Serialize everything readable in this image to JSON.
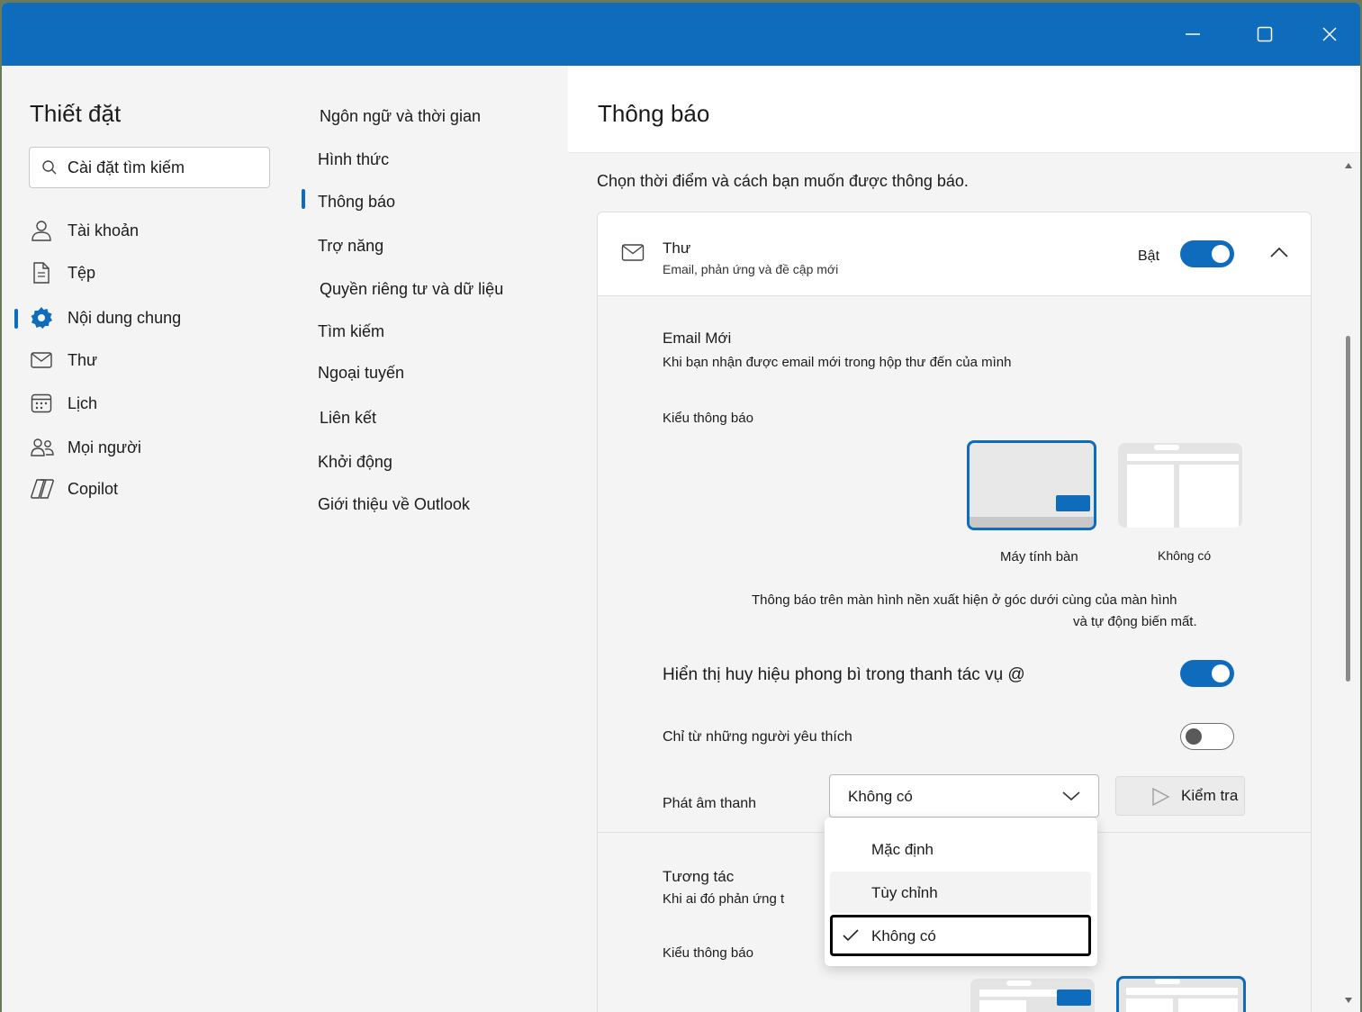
{
  "window": {
    "minimize_icon": "minimize-icon",
    "maximize_icon": "maximize-icon",
    "close_icon": "close-icon",
    "accent": "#0f6cbd"
  },
  "nav": {
    "title": "Thiết đặt",
    "search_placeholder": "Cài đặt tìm kiếm",
    "items": [
      {
        "label": "Tài khoản",
        "icon": "person-icon"
      },
      {
        "label": "Tệp",
        "icon": "document-icon"
      },
      {
        "label": "Nội dung chung",
        "icon": "gear-icon",
        "selected": true
      },
      {
        "label": "Thư",
        "icon": "mail-icon"
      },
      {
        "label": "Lịch",
        "icon": "calendar-icon"
      },
      {
        "label": "Mọi người",
        "icon": "people-icon"
      },
      {
        "label": "Copilot",
        "icon": "copilot-icon"
      }
    ]
  },
  "subnav": {
    "items": [
      {
        "label": "Ngôn ngữ và thời gian"
      },
      {
        "label": "Hình thức"
      },
      {
        "label": "Thông báo",
        "selected": true
      },
      {
        "label": "Trợ năng"
      },
      {
        "label": "Quyền riêng tư và dữ liệu"
      },
      {
        "label": "Tìm kiếm"
      },
      {
        "label": "Ngoại tuyến"
      },
      {
        "label": "Liên kết"
      },
      {
        "label": "Khởi động"
      },
      {
        "label": "Giới thiệu về Outlook"
      }
    ]
  },
  "content": {
    "title": "Thông báo",
    "intro": "Chọn thời điểm và cách bạn muốn được thông báo.",
    "mail_card": {
      "title": "Thư",
      "subtitle": "Email, phản ứng và đề cập mới",
      "state_label": "Bật",
      "enabled": true
    },
    "new_email": {
      "title": "Email Mới",
      "description": "Khi bạn nhận được email mới trong hộp thư đến của mình",
      "type_label": "Kiểu thông báo",
      "options": [
        {
          "label": "Máy tính bàn",
          "selected": true
        },
        {
          "label": "Không có",
          "selected": false
        }
      ],
      "help_line1": "Thông báo trên màn hình nền xuất hiện ở góc dưới cùng của màn hình",
      "help_line2": "và tự động biến mất."
    },
    "badge_setting": {
      "label": "Hiển thị huy hiệu phong bì trong thanh tác vụ @",
      "enabled": true
    },
    "favorites_setting": {
      "label": "Chỉ từ những người yêu thích",
      "enabled": false
    },
    "sound": {
      "label": "Phát âm thanh",
      "value": "Không có",
      "test_label": "Kiểm tra"
    },
    "reactions": {
      "title": "Tương tác",
      "description": "Khi ai đó phản ứng t",
      "type_label": "Kiểu thông báo"
    }
  },
  "sound_menu": {
    "options": [
      {
        "label": "Mặc định",
        "checked": false
      },
      {
        "label": "Tùy chỉnh",
        "checked": false
      },
      {
        "label": "Không có",
        "checked": true
      }
    ]
  }
}
